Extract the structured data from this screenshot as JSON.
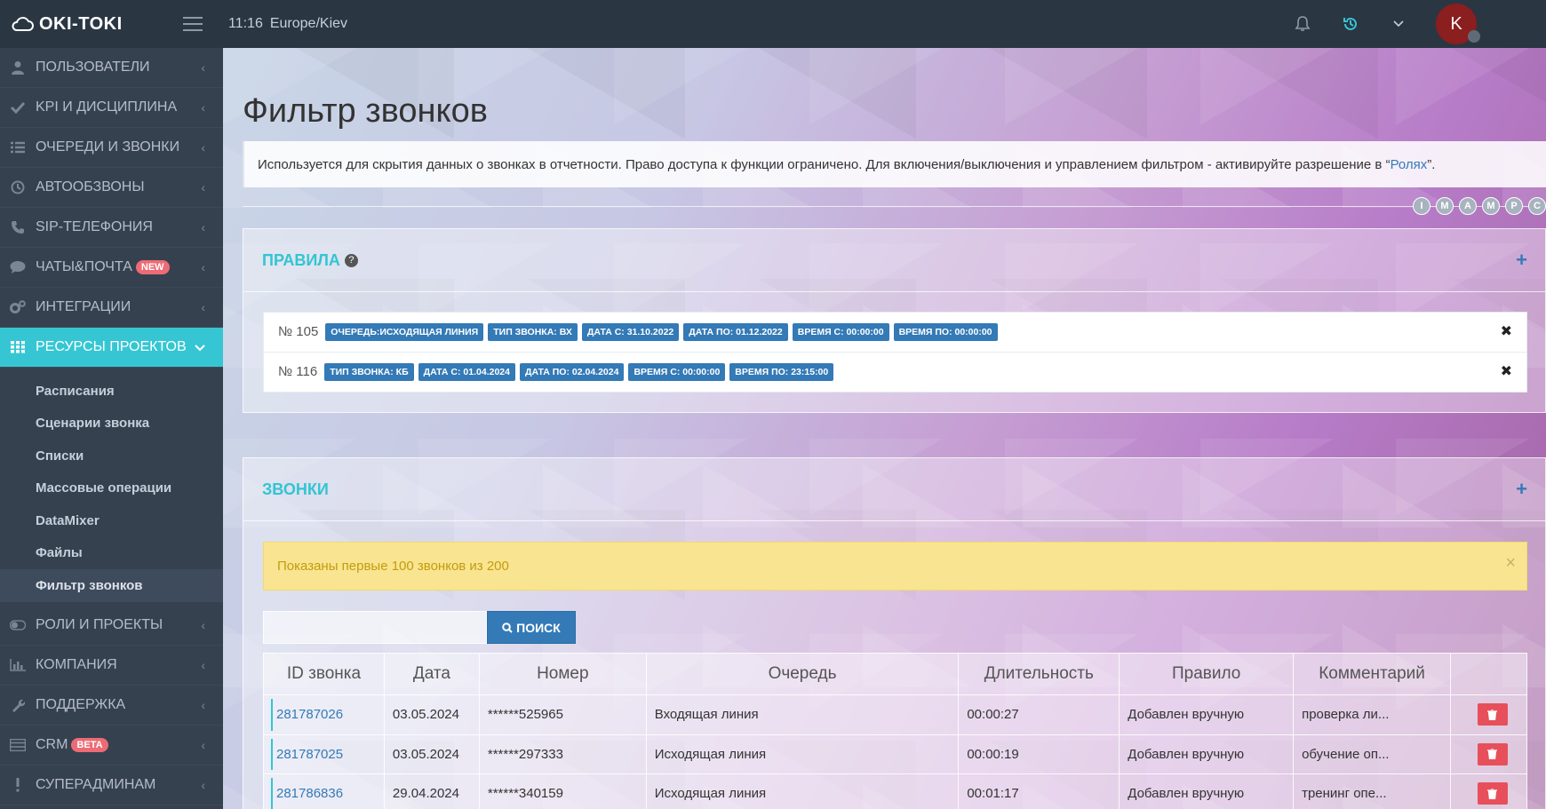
{
  "header": {
    "logo_text": "OKI-TOKI",
    "time": "11:16",
    "timezone": "Europe/Kiev",
    "avatar_letter": "K"
  },
  "sidebar": {
    "items": [
      {
        "label": "ПОЛЬЗОВАТЕЛИ",
        "icon": "user-icon"
      },
      {
        "label": "KPI И ДИСЦИПЛИНА",
        "icon": "check-icon"
      },
      {
        "label": "ОЧЕРЕДИ И ЗВОНКИ",
        "icon": "list-icon"
      },
      {
        "label": "АВТООБЗВОНЫ",
        "icon": "clock-icon"
      },
      {
        "label": "SIP-ТЕЛЕФОНИЯ",
        "icon": "phone-icon"
      },
      {
        "label": "ЧАТЫ&ПОЧТА",
        "icon": "chat-icon",
        "badge": "NEW"
      },
      {
        "label": "ИНТЕГРАЦИИ",
        "icon": "gears-icon"
      },
      {
        "label": "РЕСУРСЫ ПРОЕКТОВ",
        "icon": "grid-icon"
      }
    ],
    "sub_items": [
      "Расписания",
      "Сценарии звонка",
      "Списки",
      "Массовые операции",
      "DataMixer",
      "Файлы",
      "Фильтр звонков"
    ],
    "bottom_items": [
      {
        "label": "РОЛИ И ПРОЕКТЫ",
        "icon": "toggle-icon"
      },
      {
        "label": "КОМПАНИЯ",
        "icon": "bar-chart-icon"
      },
      {
        "label": "ПОДДЕРЖКА",
        "icon": "wrench-icon"
      },
      {
        "label": "CRM",
        "icon": "table-icon",
        "badge": "BETA"
      },
      {
        "label": "СУПЕРАДМИНАМ",
        "icon": "exclamation-icon"
      }
    ]
  },
  "page": {
    "title": "Фильтр звонков",
    "note_text": "Используется для скрытия данных о звонках в отчетности. Право доступа к функции ограничено. Для включения/выключения и управлением фильтром - активируйте разрешение в “",
    "note_link": "Ролях",
    "note_end": "”.",
    "dots": [
      "I",
      "M",
      "A",
      "M",
      "P",
      "C"
    ]
  },
  "rules_panel": {
    "title": "ПРАВИЛА",
    "rules": [
      {
        "num": "№ 105",
        "tags": [
          "ОЧЕРЕДЬ:ИСХОДЯЩАЯ ЛИНИЯ",
          "ТИП ЗВОНКА: ВХ",
          "ДАТА С: 31.10.2022",
          "ДАТА ПО: 01.12.2022",
          "ВРЕМЯ С: 00:00:00",
          "ВРЕМЯ ПО: 00:00:00"
        ]
      },
      {
        "num": "№ 116",
        "tags": [
          "ТИП ЗВОНКА: КБ",
          "ДАТА С: 01.04.2024",
          "ДАТА ПО: 02.04.2024",
          "ВРЕМЯ С: 00:00:00",
          "ВРЕМЯ ПО: 23:15:00"
        ]
      }
    ]
  },
  "calls_panel": {
    "title": "ЗВОНКИ",
    "alert": "Показаны первые 100 звонков из 200",
    "search_button": "ПОИСК",
    "columns": [
      "ID звонка",
      "Дата",
      "Номер",
      "Очередь",
      "Длительность",
      "Правило",
      "Комментарий",
      ""
    ],
    "rows": [
      {
        "id": "281787026",
        "date": "03.05.2024",
        "number": "******525965",
        "queue": "Входящая линия",
        "duration": "00:00:27",
        "rule": "Добавлен вручную",
        "comment": "проверка ли..."
      },
      {
        "id": "281787025",
        "date": "03.05.2024",
        "number": "******297333",
        "queue": "Исходящая линия",
        "duration": "00:00:19",
        "rule": "Добавлен вручную",
        "comment": "обучение оп..."
      },
      {
        "id": "281786836",
        "date": "29.04.2024",
        "number": "******340159",
        "queue": "Исходящая линия",
        "duration": "00:01:17",
        "rule": "Добавлен вручную",
        "comment": "тренинг опе..."
      }
    ]
  }
}
